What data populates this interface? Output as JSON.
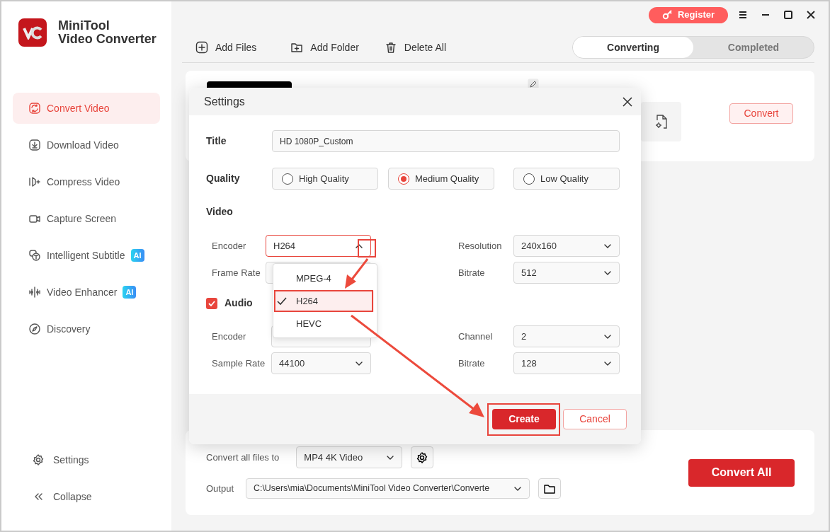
{
  "app": {
    "title_lines": [
      "MiniTool",
      "Video Converter"
    ]
  },
  "sidebar": {
    "items": [
      {
        "label": "Convert Video",
        "selected": true
      },
      {
        "label": "Download Video",
        "selected": false
      },
      {
        "label": "Compress Video",
        "selected": false
      },
      {
        "label": "Capture Screen",
        "selected": false
      },
      {
        "label": "Intelligent Subtitle",
        "selected": false,
        "badge": "AI"
      },
      {
        "label": "Video Enhancer",
        "selected": false,
        "badge": "AI"
      },
      {
        "label": "Discovery",
        "selected": false
      }
    ],
    "bottom": [
      "Settings",
      "Collapse"
    ]
  },
  "header": {
    "register": "Register"
  },
  "toolbar": [
    "Add Files",
    "Add Folder",
    "Delete All"
  ],
  "tabs": [
    {
      "label": "Converting",
      "selected": true
    },
    {
      "label": "Completed",
      "selected": false
    }
  ],
  "file": {
    "convert": "Convert"
  },
  "bottom": {
    "convert_all_label": "Convert all files to",
    "format": "MP4 4K Video",
    "output_label": "Output",
    "output_path": "C:\\Users\\mia\\Documents\\MiniTool Video Converter\\Converte",
    "convert_all": "Convert All"
  },
  "dialog": {
    "title": "Settings",
    "title_label": "Title",
    "title_value": "HD 1080P_Custom",
    "quality_label": "Quality",
    "quality_options": [
      {
        "label": "High Quality",
        "selected": false
      },
      {
        "label": "Medium Quality",
        "selected": true
      },
      {
        "label": "Low Quality",
        "selected": false
      }
    ],
    "video_heading": "Video",
    "video_rows": [
      {
        "left": {
          "label": "Encoder",
          "value": "H264",
          "expanded": true
        },
        "right": {
          "label": "Resolution",
          "value": "240x160"
        }
      },
      {
        "left": {
          "label": "Frame Rate"
        },
        "right": {
          "label": "Bitrate",
          "value": "512"
        }
      }
    ],
    "audio": {
      "label": "Audio",
      "checked": true
    },
    "audio_rows": [
      {
        "left": {
          "label": "Encoder"
        },
        "right": {
          "label": "Channel",
          "value": "2"
        }
      },
      {
        "left": {
          "label": "Sample Rate",
          "value": "44100"
        },
        "right": {
          "label": "Bitrate",
          "value": "128"
        }
      }
    ],
    "encoder_options": [
      {
        "label": "MPEG-4",
        "selected": false
      },
      {
        "label": "H264",
        "selected": true
      },
      {
        "label": "HEVC",
        "selected": false
      }
    ],
    "create": "Create",
    "cancel": "Cancel"
  }
}
